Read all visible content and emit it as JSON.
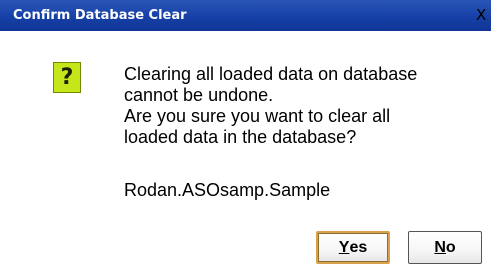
{
  "window": {
    "title": "Confirm Database Clear",
    "close_glyph": "X"
  },
  "icon": {
    "name": "question-icon",
    "glyph": "?",
    "color": "#c5e61a"
  },
  "message": {
    "lines": [
      "Clearing all loaded data on database",
      "cannot be undone.",
      "Are you sure you want to clear all",
      "loaded data in the database?"
    ],
    "database_name": "Rodan.ASOsamp.Sample"
  },
  "buttons": {
    "yes": {
      "accel": "Y",
      "rest": "es"
    },
    "no": {
      "accel": "N",
      "rest": "o"
    }
  },
  "colors": {
    "titlebar": "#1640a6",
    "default_button_border": "#d9a24a"
  }
}
